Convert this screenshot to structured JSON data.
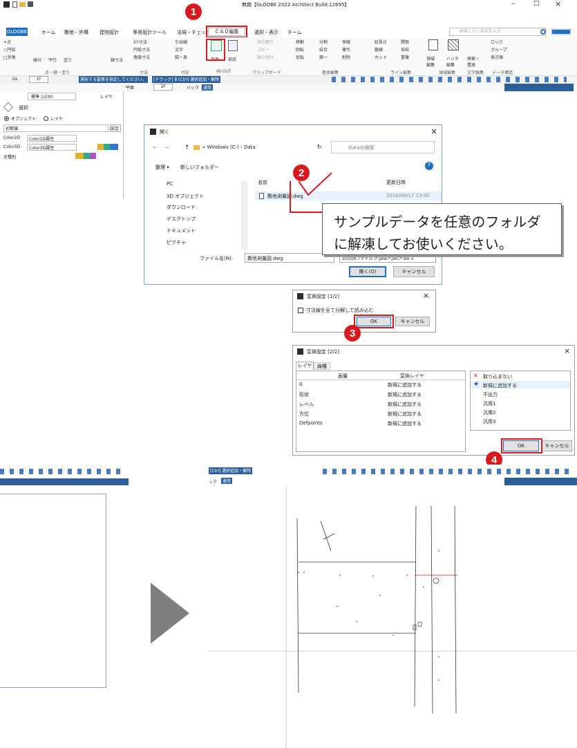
{
  "app": {
    "title": "無題【GLOOBE 2022 Architect Build:12695】",
    "win_min": "–",
    "win_max": "□",
    "win_close": "×",
    "search_placeholder": "検索したい語句を入力",
    "tabs": [
      "GLOOBE",
      "ホーム",
      "敷地・外構",
      "建物設計",
      "専用設計ツール",
      "法規・チェック",
      "ＣＡＤ編集",
      "選択・表示",
      "チーム"
    ],
    "ribbon_tools": {
      "pt": "+点",
      "circle": "○円弧",
      "poly": "□多角",
      "line": "線分",
      "parallel": "平行",
      "paint": "塗り",
      "shape_paint": "塗状\n塗り",
      "dim": "線寸法",
      "xy_dim": "XY寸法",
      "arc_dim": "円弧寸法",
      "ang_dim": "角度寸法",
      "leader": "引出線",
      "text": "文字",
      "figure": "図・表",
      "convert": "変換",
      "parts": "部品",
      "cut": "切り取り",
      "copy": "コピー",
      "paste": "貼り付け",
      "move": "移動",
      "rotate": "回転",
      "mirror": "反転",
      "split": "分割",
      "join": "結合",
      "one": "面一",
      "stretch": "伸縮",
      "multi": "複写",
      "delete": "削除",
      "extend": "延長止",
      "fold": "繋線",
      "cut2": "カット",
      "rounding": "隅取",
      "compose": "各結",
      "overlap": "重複",
      "region": "領域\n編集",
      "hatch": "ハッチ\n編集",
      "search": "検索・\n置換",
      "lock": "ロック",
      "group": "グループ",
      "display_order": "表示順"
    },
    "ribbon_groups": [
      "点・線・塗り",
      "寸法",
      "付記",
      "IN-OUT",
      "クリップボード",
      "基本編集",
      "ライン編集",
      "領域編集",
      "文字編集",
      "データ構造"
    ],
    "toolbar": {
      "gl": "GL",
      "floor": "1F",
      "hint": "選択する要素を指定してください。",
      "drag": "[ドラッグ] 範囲選択",
      "ctrl": "[Ctrl] 選択追加・解除",
      "plan": "平面",
      "view_floor": "1F",
      "back": "バック",
      "normal": "通常",
      "scale": "標準 1/100",
      "layer": "レイヤ"
    }
  },
  "side_panel": {
    "header": "選択",
    "mode_object": "オブジェクト",
    "mode_layer": "レイヤ",
    "preset": "初期値",
    "settings": "設定",
    "color2d_label": "Color2D",
    "color2d_value": "Color2D属性",
    "color3d_label": "Color3D",
    "color3d_value": "Color3D属性",
    "kind_label": "全種別"
  },
  "open_dialog": {
    "title": "開く",
    "breadcrumb": "« Windows (C:) › Data",
    "search_placeholder": "Dataの検索",
    "organize": "整理 ▾",
    "new_folder": "新しいフォルダー",
    "nav_items": [
      "PC",
      "3D オブジェクト",
      "ダウンロード",
      "デスクトップ",
      "ドキュメント",
      "ピクチャ"
    ],
    "col_name": "名前",
    "col_date": "更新日時",
    "file_name": "敷地測量図.dwg",
    "file_date": "2016/06/17 13:30",
    "filename_label": "ファイル名(N):",
    "filename_value": "敷地測量図.dwg",
    "filetype": "2D汎用ファイル (*.jww;*.jwc;*.dw ∨",
    "open": "開く(O)",
    "cancel": "キャンセル"
  },
  "callout": {
    "text_line1": "サンプルデータを任意のフォルダ",
    "text_line2": "に解凍してお使いください。"
  },
  "convert1": {
    "title": "変換設定 [1/2]",
    "close": "×",
    "checkbox": "寸法線を全て分解して読み込む",
    "ok": "OK",
    "cancel": "キャンセル"
  },
  "convert2": {
    "title": "変換設定 [2/2]",
    "close": "×",
    "tab_layer": "レイヤ",
    "tab_linetype": "線種",
    "col_layer": "画層",
    "col_target": "変換レイヤ",
    "rows": [
      {
        "layer": "0",
        "target": "新規に追加する"
      },
      {
        "layer": "形状",
        "target": "新規に追加する"
      },
      {
        "layer": "レベル",
        "target": "新規に追加する"
      },
      {
        "layer": "方位",
        "target": "新規に追加する"
      },
      {
        "layer": "Defpoints",
        "target": "新規に追加する"
      }
    ],
    "options": [
      {
        "label": "取り込まない",
        "mark": "✕",
        "color": "#d81920"
      },
      {
        "label": "新規に追加する",
        "mark": "★",
        "color": "#1b4fc4"
      },
      {
        "label": "不出力",
        "mark": "",
        "color": ""
      },
      {
        "label": "汎用1",
        "mark": "",
        "color": ""
      },
      {
        "label": "汎用2",
        "mark": "",
        "color": ""
      },
      {
        "label": "汎用3",
        "mark": "",
        "color": ""
      }
    ],
    "ok": "OK",
    "cancel": "キャンセル"
  },
  "badges": [
    "1",
    "2",
    "3",
    "4"
  ],
  "result": {
    "drag": "[Ctrl] 選択追加・解除",
    "back": "ック",
    "normal": "通常"
  },
  "colors": {
    "accent": "#d81920",
    "ribbon_blue": "#1e6fc2",
    "bar_blue": "#2c5f9a"
  }
}
